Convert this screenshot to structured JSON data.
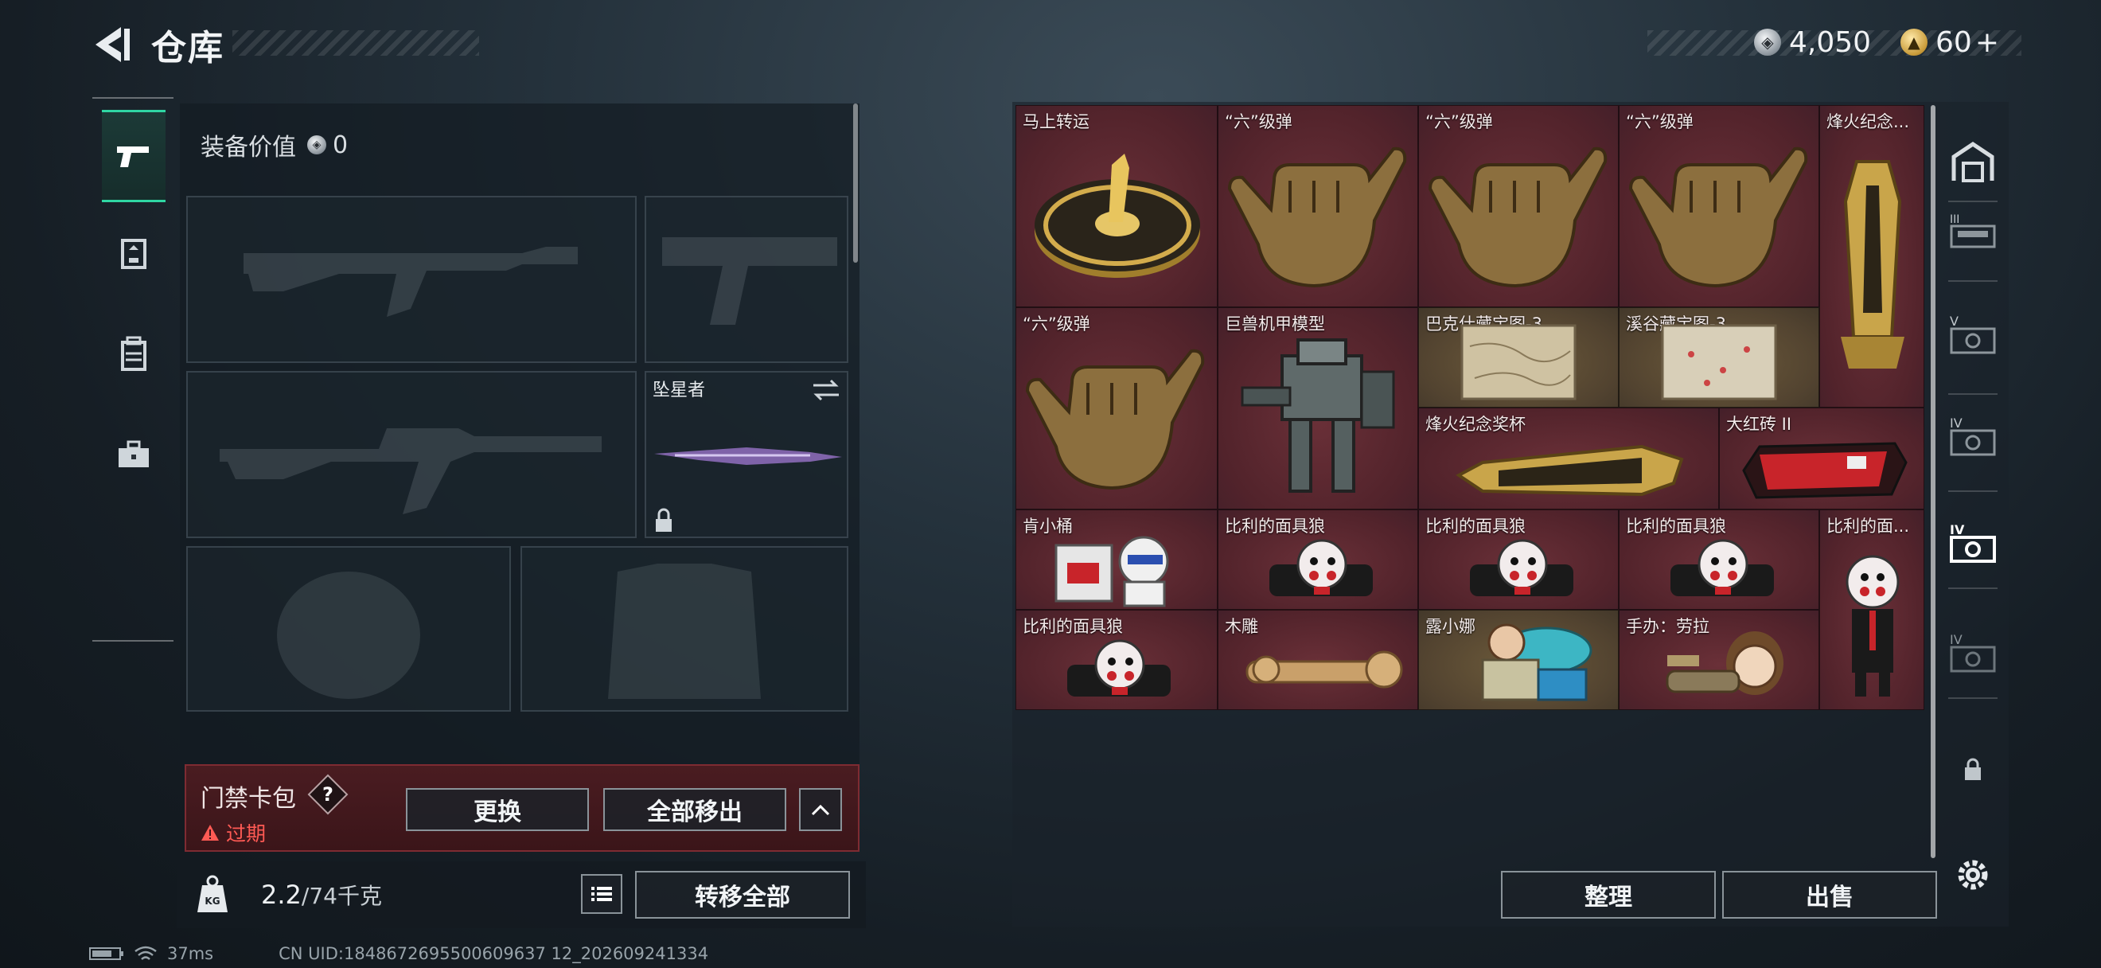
{
  "header": {
    "title": "仓库"
  },
  "currency": {
    "silver_value": "4,050",
    "gold_value": "60",
    "gold_plus": "+"
  },
  "equipment": {
    "label": "装备价值",
    "value": "0",
    "melee_name": "坠星者"
  },
  "access_card": {
    "title": "门禁卡包",
    "help": "?",
    "status": "过期",
    "swap_label": "更换",
    "remove_all_label": "全部移出"
  },
  "weight": {
    "current": "2.2",
    "max": "/74千克"
  },
  "actions": {
    "transfer_all": "转移全部",
    "organize": "整理",
    "sell": "出售"
  },
  "storage_items": [
    {
      "label": "马上转运",
      "icon": "coin-token-icon"
    },
    {
      "label": "“六”级弹",
      "icon": "hand-sign-icon"
    },
    {
      "label": "“六”级弹",
      "icon": "hand-sign-icon"
    },
    {
      "label": "“六”级弹",
      "icon": "hand-sign-icon"
    },
    {
      "label": "烽火纪念...",
      "icon": "trophy-pillar-icon"
    },
    {
      "label": "“六”级弹",
      "icon": "hand-sign-icon"
    },
    {
      "label": "巨兽机甲模型",
      "icon": "mech-model-icon"
    },
    {
      "label": "巴克什藏宝图-3",
      "icon": "map-icon"
    },
    {
      "label": "溪谷藏宝图-3",
      "icon": "map-icon"
    },
    {
      "label": "烽火纪念奖杯",
      "icon": "trophy-icon"
    },
    {
      "label": "大红砖 II",
      "icon": "red-brick-icon"
    },
    {
      "label": "肯小桶",
      "icon": "bucket-figure-icon"
    },
    {
      "label": "比利的面具狼",
      "icon": "doll-icon"
    },
    {
      "label": "比利的面具狼",
      "icon": "doll-icon"
    },
    {
      "label": "比利的面具狼",
      "icon": "doll-icon"
    },
    {
      "label": "比利的面...",
      "icon": "doll-icon"
    },
    {
      "label": "比利的面具狼",
      "icon": "doll-icon"
    },
    {
      "label": "木雕",
      "icon": "wood-carving-icon"
    },
    {
      "label": "露小娜",
      "icon": "figurine-icon"
    },
    {
      "label": "手办：劳拉",
      "icon": "figurine-icon"
    }
  ],
  "status_bar": {
    "ping": "37ms",
    "uid": "CN UID:1848672695500609637 12_202609241334"
  },
  "colors": {
    "accent": "#2fd6a3",
    "danger": "#ff5a54",
    "item_bg": "#52232b"
  }
}
